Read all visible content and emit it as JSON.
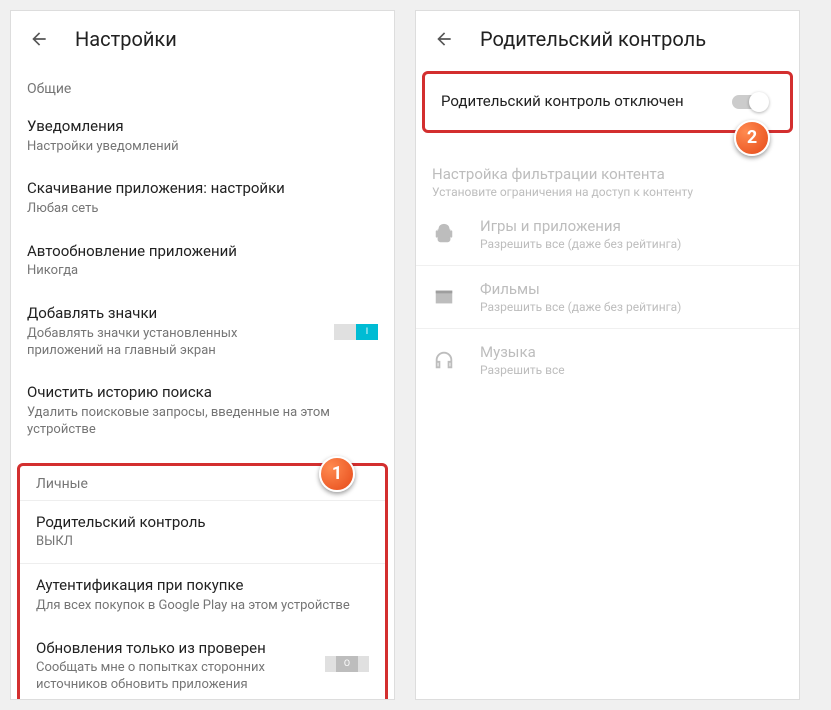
{
  "left": {
    "title": "Настройки",
    "section1": "Общие",
    "notifications": {
      "title": "Уведомления",
      "sub": "Настройки уведомлений"
    },
    "download": {
      "title": "Скачивание приложения: настройки",
      "sub": "Любая сеть"
    },
    "autoupdate": {
      "title": "Автообновление приложений",
      "sub": "Никогда"
    },
    "addicons": {
      "title": "Добавлять значки",
      "sub": "Добавлять значки установленных приложений на главный экран"
    },
    "clearhistory": {
      "title": "Очистить историю поиска",
      "sub": "Удалить поисковые запросы, введенные на этом устройстве"
    },
    "section2": "Личные",
    "parental": {
      "title": "Родительский контроль",
      "sub": "ВЫКЛ"
    },
    "auth": {
      "title": "Аутентификация при покупке",
      "sub": "Для всех покупок в Google Play на этом устройстве"
    },
    "verified": {
      "title": "Обновления только из проверен",
      "sub": "Сообщать мне о попытках сторонних источников обновить приложения"
    }
  },
  "right": {
    "title": "Родительский контроль",
    "switch_label": "Родительский контроль отключен",
    "filter": {
      "title": "Настройка фильтрации контента",
      "sub": "Установите ограничения на доступ к контенту"
    },
    "cat_games": {
      "title": "Игры и приложения",
      "sub": "Разрешить все (даже без рейтинга)"
    },
    "cat_movies": {
      "title": "Фильмы",
      "sub": "Разрешить все (даже без рейтинга)"
    },
    "cat_music": {
      "title": "Музыка",
      "sub": "Разрешить все"
    }
  },
  "markers": {
    "one": "1",
    "two": "2"
  }
}
